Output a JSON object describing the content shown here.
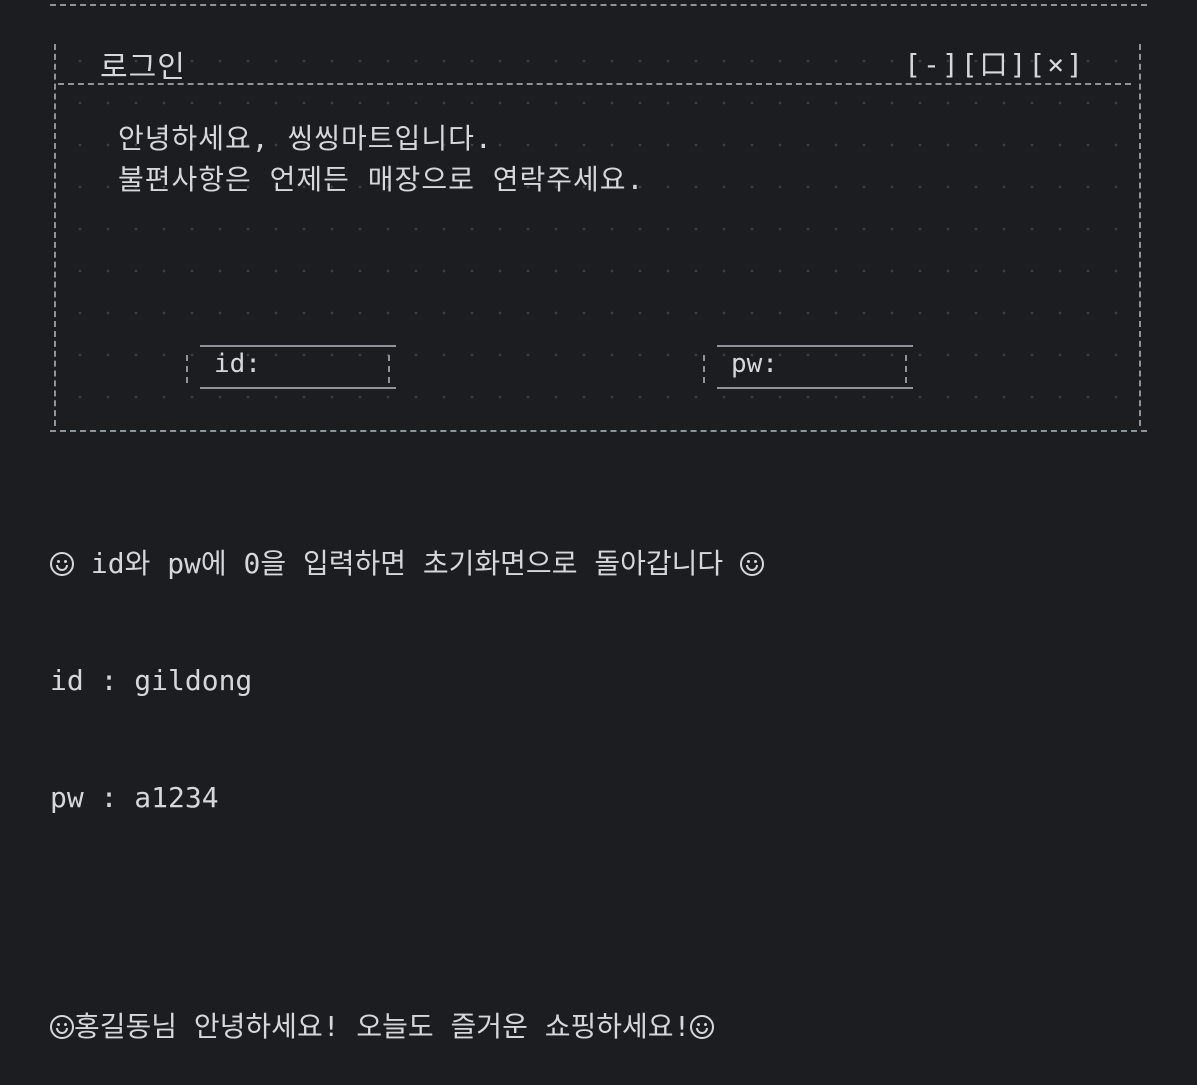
{
  "window": {
    "title": "로그인",
    "controls": "[-][口][×]"
  },
  "welcome": {
    "line1": "안녕하세요, 씽씽마트입니다.",
    "line2": "불편사항은 언제든 매장으로 연락주세요."
  },
  "fields": {
    "id_label": "id:",
    "pw_label": "pw:"
  },
  "console": {
    "hint": " id와 pw에 0을 입력하면 초기화면으로 돌아갑니다 ",
    "id_line": "id : gildong",
    "pw_line": "pw : a1234",
    "greeting": "홍길동님 안녕하세요! 오늘도 즐거운 쇼핑하세요!"
  },
  "icons": {
    "smiley": "smiley-face-icon"
  },
  "colors": {
    "background": "#1b1d20",
    "text": "#d4d8dc",
    "border": "#8d949b"
  }
}
